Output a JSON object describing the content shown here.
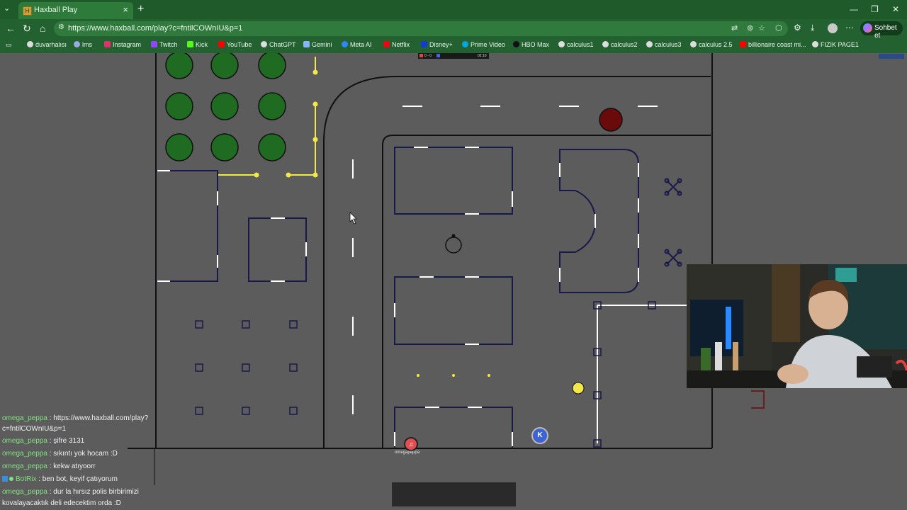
{
  "browser": {
    "tab_title": "Haxball Play",
    "tab_favicon": "haxball-icon",
    "url": "https://www.haxball.com/play?c=fntilCOWnIU&p=1",
    "chat_button": "Sohbet et",
    "bookmarks": [
      "duvarhalısı",
      "lms",
      "Instagram",
      "Twitch",
      "Kick",
      "YouTube",
      "ChatGPT",
      "Gemini",
      "Meta AI",
      "Netflix",
      "Disney+",
      "Prime Video",
      "HBO Max",
      "calculus1",
      "calculus2",
      "calculus3",
      "calculus 2.5",
      "billionaire coast mi...",
      "FIZIK PAGE1"
    ]
  },
  "game": {
    "scoreboard_left": "0 - 0",
    "scoreboard_time": "02:10",
    "player_red_avatar": "♫",
    "player_blue_avatar": "K",
    "player_red_name": "omegapeppa"
  },
  "chat": {
    "messages": [
      {
        "user": "omega_peppa",
        "text": " : https://www.haxball.com/play?"
      },
      {
        "user": "",
        "text": "c=fntilCOWnIU&p=1"
      },
      {
        "user": "omega_peppa",
        "text": " : şifre 3131"
      },
      {
        "user": "omega_peppa",
        "text": " : sıkıntı yok hocam :D"
      },
      {
        "user": "omega_peppa",
        "text": " : kekw atıyoorr"
      },
      {
        "user": "BotRix",
        "text": " : ben bot, keyif çatıyorum"
      },
      {
        "user": "omega_peppa",
        "text": " : dur la hırsız polis birbirimizi"
      },
      {
        "user": "",
        "text": "kovalayacaktık deli edecektim orda :D"
      }
    ]
  },
  "colors": {
    "tabbar": "#1f5b2a",
    "field": "#5c5c5c",
    "wall": "#1a1a4a",
    "yellow": "#f2e84a",
    "tree": "#1f6b22",
    "red_ball": "#6b0a0a"
  }
}
